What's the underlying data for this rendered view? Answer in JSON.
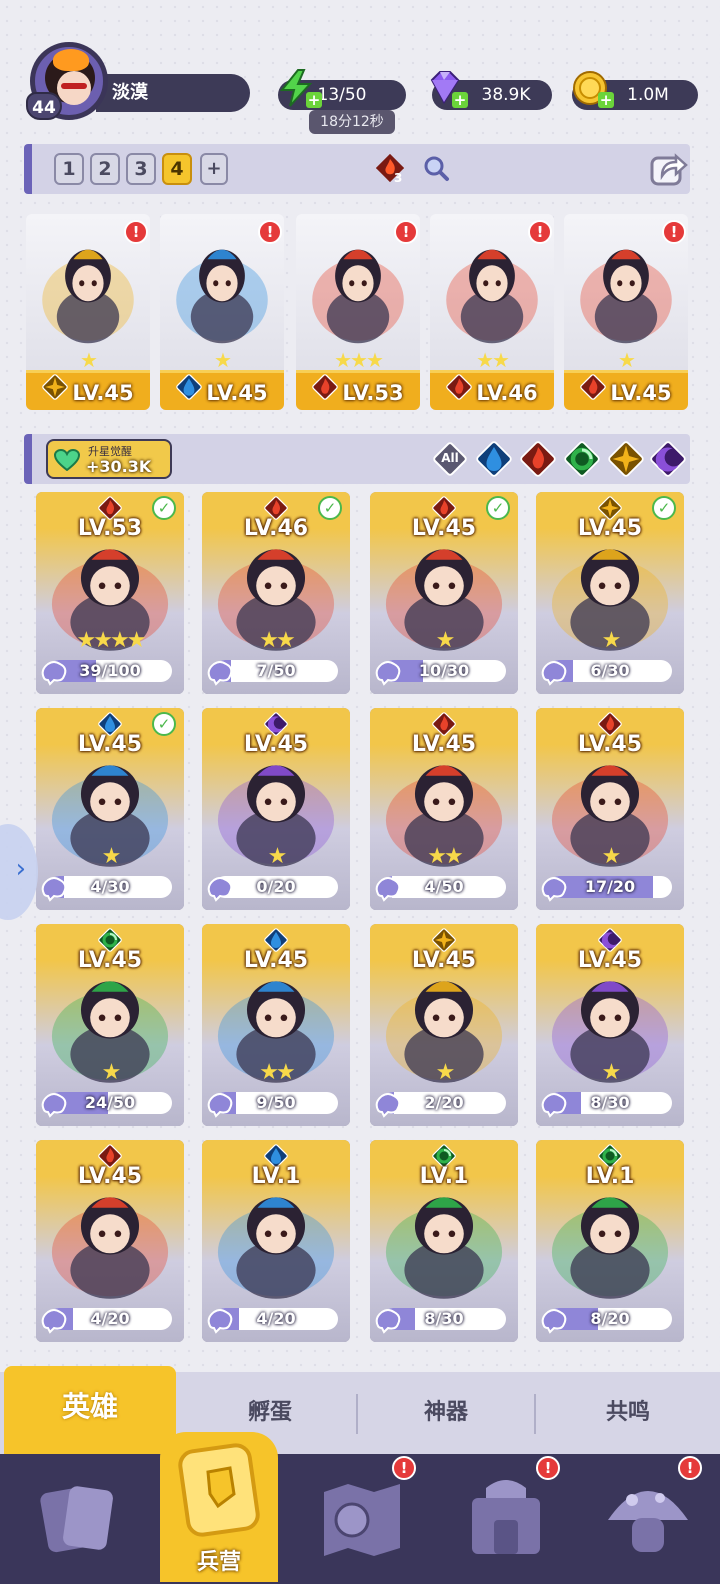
{
  "player": {
    "name": "淡漠",
    "level": "44"
  },
  "resources": {
    "energy": "13/50",
    "energy_timer": "18分12秒",
    "gems": "38.9K",
    "gold": "1.0M"
  },
  "team_bar": {
    "tabs": [
      "1",
      "2",
      "3",
      "4"
    ],
    "active_tab": "4",
    "add_label": "+",
    "fire_count": "3"
  },
  "team_slots": [
    {
      "element": "light",
      "stars": "★",
      "level": "LV.45",
      "alert": "!"
    },
    {
      "element": "water",
      "stars": "★",
      "level": "LV.45",
      "alert": "!"
    },
    {
      "element": "fire",
      "stars": "★★★",
      "level": "LV.53",
      "alert": "!"
    },
    {
      "element": "fire",
      "stars": "★★",
      "level": "LV.46",
      "alert": "!"
    },
    {
      "element": "fire",
      "stars": "★",
      "level": "LV.45",
      "alert": "!"
    }
  ],
  "filter_bar": {
    "awaken_label": "升星觉醒",
    "awaken_value": "+30.3K",
    "filters": [
      "All",
      "water",
      "fire",
      "wind",
      "light",
      "dark"
    ]
  },
  "heroes": [
    {
      "element": "fire",
      "level": "LV.53",
      "stars": "★★★★",
      "shards": "39/100",
      "progress": 0.39,
      "checked": true
    },
    {
      "element": "fire",
      "level": "LV.46",
      "stars": "★★",
      "shards": "7/50",
      "progress": 0.14,
      "checked": true
    },
    {
      "element": "fire",
      "level": "LV.45",
      "stars": "★",
      "shards": "10/30",
      "progress": 0.33,
      "checked": true
    },
    {
      "element": "light",
      "level": "LV.45",
      "stars": "★",
      "shards": "6/30",
      "progress": 0.2,
      "checked": true
    },
    {
      "element": "water",
      "level": "LV.45",
      "stars": "★",
      "shards": "4/30",
      "progress": 0.13,
      "checked": true
    },
    {
      "element": "dark",
      "level": "LV.45",
      "stars": "★",
      "shards": "0/20",
      "progress": 0.0,
      "checked": false
    },
    {
      "element": "fire",
      "level": "LV.45",
      "stars": "★★",
      "shards": "4/50",
      "progress": 0.08,
      "checked": false
    },
    {
      "element": "fire",
      "level": "LV.45",
      "stars": "★",
      "shards": "17/20",
      "progress": 0.85,
      "checked": false
    },
    {
      "element": "wind",
      "level": "LV.45",
      "stars": "★",
      "shards": "24/50",
      "progress": 0.48,
      "checked": false
    },
    {
      "element": "water",
      "level": "LV.45",
      "stars": "★★",
      "shards": "9/50",
      "progress": 0.18,
      "checked": false
    },
    {
      "element": "light",
      "level": "LV.45",
      "stars": "★",
      "shards": "2/20",
      "progress": 0.1,
      "checked": false
    },
    {
      "element": "dark",
      "level": "LV.45",
      "stars": "★",
      "shards": "8/30",
      "progress": 0.27,
      "checked": false
    },
    {
      "element": "fire",
      "level": "LV.45",
      "stars": "",
      "shards": "4/20",
      "progress": 0.2,
      "checked": false
    },
    {
      "element": "water",
      "level": "LV.1",
      "stars": "",
      "shards": "4/20",
      "progress": 0.2,
      "checked": false
    },
    {
      "element": "wind",
      "level": "LV.1",
      "stars": "",
      "shards": "8/30",
      "progress": 0.27,
      "checked": false
    },
    {
      "element": "wind",
      "level": "LV.1",
      "stars": "",
      "shards": "8/20",
      "progress": 0.4,
      "checked": false
    }
  ],
  "sub_tabs": [
    "英雄",
    "孵蛋",
    "神器",
    "共鸣"
  ],
  "bottom_nav": {
    "center_label": "兵营",
    "alert": "!"
  },
  "colors": {
    "fire": "#e8422a",
    "water": "#2f8fe0",
    "wind": "#2fb24a",
    "light": "#f1b21a",
    "dark": "#8a4fd8",
    "accent_yellow": "#f6c42a",
    "nav_bg": "#3a365a"
  }
}
